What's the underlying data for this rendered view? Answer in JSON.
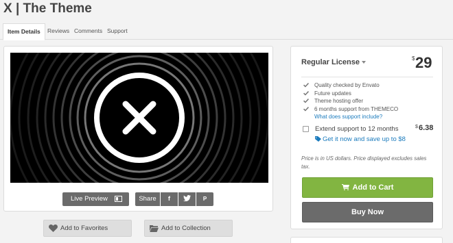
{
  "page": {
    "title": "X | The Theme"
  },
  "tabs": [
    {
      "label": "Item Details",
      "active": true
    },
    {
      "label": "Reviews"
    },
    {
      "label": "Comments"
    },
    {
      "label": "Support"
    }
  ],
  "preview": {
    "live_preview_label": "Live Preview",
    "share_label": "Share",
    "share_icons": [
      "facebook-icon",
      "twitter-icon",
      "pinterest-icon"
    ],
    "facebook_glyph": "f",
    "pinterest_glyph": "P"
  },
  "actions": {
    "favorites_label": "Add to Favorites",
    "collection_label": "Add to Collection"
  },
  "license": {
    "name": "Regular License",
    "currency_symbol": "$",
    "price": "29",
    "features": [
      "Quality checked by Envato",
      "Future updates",
      "Theme hosting offer",
      "6 months support from THEMECO"
    ],
    "support_link": "What does support include?",
    "extend_label": "Extend support to 12 months",
    "extend_price": "6.38",
    "extend_checked": false,
    "save_link": "Get it now and save up to $8",
    "price_note": "Price is in US dollars. Price displayed excludes sales tax.",
    "add_to_cart": "Add to Cart",
    "buy_now": "Buy Now"
  },
  "colors": {
    "accent_green": "#82b541",
    "button_gray": "#6b6b6b",
    "link_blue": "#1b7bbd"
  }
}
